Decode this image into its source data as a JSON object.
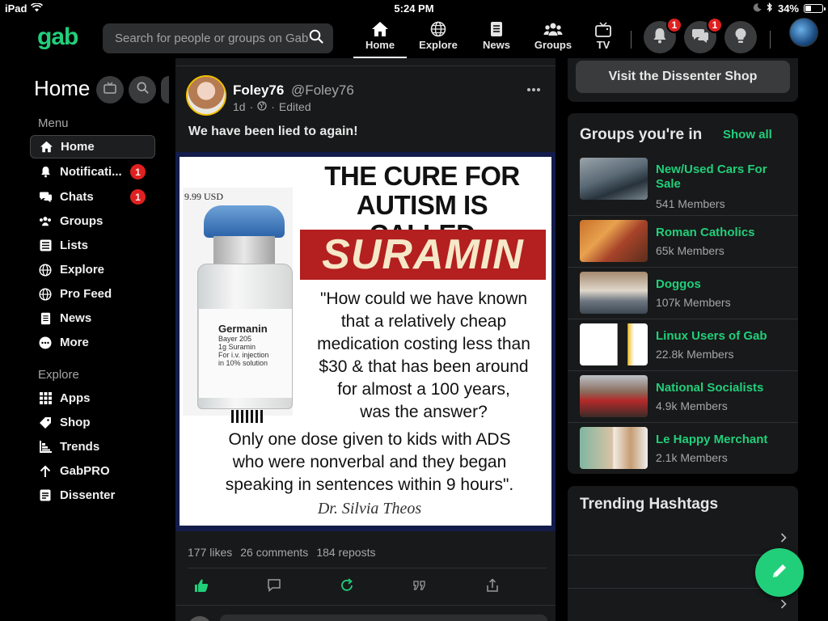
{
  "status_bar": {
    "device": "iPad",
    "time": "5:24 PM",
    "battery": "34%",
    "battery_level": 0.34
  },
  "brand": {
    "logo": "gab",
    "accent": "#21cf7a",
    "badge_color": "#e02020"
  },
  "search": {
    "placeholder": "Search for people or groups on Gab"
  },
  "nav_tabs": [
    {
      "label": "Home",
      "icon": "home-icon",
      "active": true
    },
    {
      "label": "Explore",
      "icon": "globe-icon"
    },
    {
      "label": "News",
      "icon": "document-icon"
    },
    {
      "label": "Groups",
      "icon": "groups-icon"
    },
    {
      "label": "TV",
      "icon": "tv-icon"
    }
  ],
  "nav_actions": {
    "notifications_badge": "1",
    "chats_badge": "1"
  },
  "sidebar": {
    "title": "Home",
    "menu_label": "Menu",
    "menu_items": [
      {
        "label": "Home",
        "icon": "home-icon",
        "active": true
      },
      {
        "label": "Notificati...",
        "icon": "bell-icon",
        "badge": "1"
      },
      {
        "label": "Chats",
        "icon": "chat-icon",
        "badge": "1"
      },
      {
        "label": "Groups",
        "icon": "groups-icon"
      },
      {
        "label": "Lists",
        "icon": "list-icon"
      },
      {
        "label": "Explore",
        "icon": "globe-icon"
      },
      {
        "label": "Pro Feed",
        "icon": "globe-icon"
      },
      {
        "label": "News",
        "icon": "document-icon"
      },
      {
        "label": "More",
        "icon": "ellipsis-icon"
      }
    ],
    "explore_label": "Explore",
    "explore_items": [
      {
        "label": "Apps",
        "icon": "grid-icon"
      },
      {
        "label": "Shop",
        "icon": "tag-icon"
      },
      {
        "label": "Trends",
        "icon": "trends-icon"
      },
      {
        "label": "GabPRO",
        "icon": "arrow-up-icon"
      },
      {
        "label": "Dissenter",
        "icon": "dissenter-icon"
      }
    ]
  },
  "post": {
    "author_name": "Foley76",
    "author_handle": "@Foley76",
    "time": "1d",
    "edited": "Edited",
    "text": "We have been lied to again!",
    "image": {
      "price": "9.99 USD",
      "title_line1": "THE CURE FOR",
      "title_line2": "AUTISM IS CALLED",
      "highlight": "SURAMIN",
      "vial_brand": "Germanin",
      "vial_line1": "Bayer 205",
      "vial_line2": "1g Suramin",
      "vial_line3": "For i.v. injection",
      "vial_line4": "in 10% solution",
      "quote_lines": [
        "\"How could we have known",
        "that a relatively cheap",
        "medication costing less than",
        "$30 & that has been around",
        "for almost a 100 years,",
        "was the answer?"
      ],
      "quote2_lines": [
        "Only one dose given to kids with ADS",
        "who were nonverbal and they began",
        "speaking in sentences within 9 hours\"."
      ],
      "author": "Dr. Silvia Theos"
    },
    "likes": "177 likes",
    "comments": "26 comments",
    "reposts": "184 reposts"
  },
  "right": {
    "shop_button": "Visit the Dissenter Shop",
    "groups_title": "Groups you're in",
    "show_all": "Show all",
    "groups": [
      {
        "name": "New/Used Cars For Sale",
        "members": "541 Members"
      },
      {
        "name": "Roman Catholics",
        "members": "65k Members"
      },
      {
        "name": "Doggos",
        "members": "107k Members"
      },
      {
        "name": "Linux Users of Gab",
        "members": "22.8k Members"
      },
      {
        "name": "National Socialists",
        "members": "4.9k Members"
      },
      {
        "name": "Le Happy Merchant",
        "members": "2.1k Members"
      }
    ],
    "trending_title": "Trending Hashtags"
  }
}
